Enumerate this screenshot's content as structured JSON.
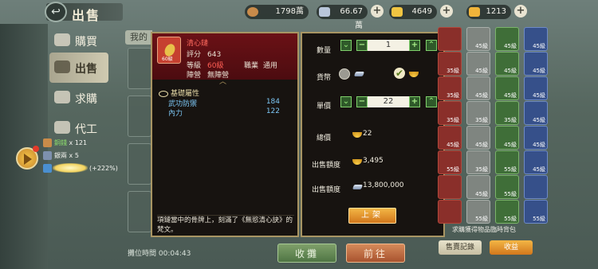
{
  "header": {
    "title": "出售",
    "resources": [
      {
        "name": "copper-coin",
        "value": "1798萬",
        "color": "#c98b4a"
      },
      {
        "name": "silver-ingot",
        "value": "66.67萬",
        "color": "#b9c6da"
      },
      {
        "name": "gold-ingot",
        "value": "4649",
        "color": "#f1c542"
      },
      {
        "name": "yuanbao",
        "value": "1213",
        "color": "#f0b43a"
      }
    ]
  },
  "nav": {
    "items": [
      {
        "label": "購買"
      },
      {
        "label": "出售"
      },
      {
        "label": "求購"
      },
      {
        "label": "代工"
      }
    ],
    "tab_mine": "我的"
  },
  "buffs": [
    {
      "label": "銅錢",
      "value": "x 121"
    },
    {
      "label": "銀兩",
      "value": "x 5"
    },
    {
      "label": "(+222%)"
    }
  ],
  "item": {
    "name": "清心鏈",
    "icon_level": "60級",
    "score_label": "評分",
    "score": "643",
    "level_label": "等級",
    "level": "60級",
    "job_label": "職業",
    "job": "通用",
    "camp_label": "陣營",
    "camp": "無陣營",
    "section": "基礎屬性",
    "attrs": [
      {
        "name": "武功防禦",
        "value": "184"
      },
      {
        "name": "內力",
        "value": "122"
      }
    ],
    "desc": "項鏈當中的骨牌上，刻滿了《無慾清心訣》的梵文。"
  },
  "sell": {
    "qty_label": "數量",
    "qty": "1",
    "currency_label": "貨幣",
    "price_label": "單價",
    "price": "22",
    "total_label": "總價",
    "total": "22",
    "quota_label": "出售額度",
    "quota_gold": "3,495",
    "quota_silver": "13,800,000",
    "submit": "上架"
  },
  "inventory": {
    "note": "求購獲得物品臨時背包",
    "btn_record": "售賣記錄",
    "btn_collect": "收益",
    "cells": [
      {
        "n": ""
      },
      {
        "n": "45級"
      },
      {
        "n": "45級"
      },
      {
        "n": "45級"
      },
      {
        "n": "35級"
      },
      {
        "n": "45級"
      },
      {
        "n": "45級"
      },
      {
        "n": "45級"
      },
      {
        "n": "35級"
      },
      {
        "n": "45級"
      },
      {
        "n": "45級"
      },
      {
        "n": "45級"
      },
      {
        "n": "35級"
      },
      {
        "n": "35級"
      },
      {
        "n": "35級"
      },
      {
        "n": "45級"
      },
      {
        "n": "45級"
      },
      {
        "n": "45級"
      },
      {
        "n": "45級"
      },
      {
        "n": "45級"
      },
      {
        "n": "55級"
      },
      {
        "n": "35級"
      },
      {
        "n": "55級"
      },
      {
        "n": "45級"
      },
      {
        "n": ""
      },
      {
        "n": "45級"
      },
      {
        "n": "55級"
      },
      {
        "n": ""
      },
      {
        "n": ""
      },
      {
        "n": "55級"
      },
      {
        "n": "55級"
      },
      {
        "n": "55級"
      }
    ]
  },
  "bottom": {
    "timer_label": "攤位時間",
    "timer": "00:04:43",
    "btn_collect": "收攤",
    "btn_go": "前往"
  }
}
